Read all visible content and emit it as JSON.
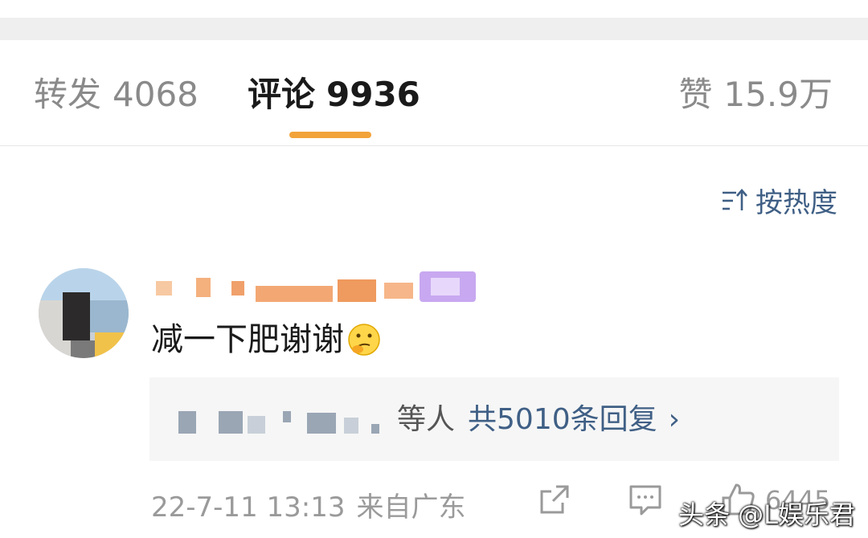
{
  "tabs": [
    {
      "label": "转发",
      "count": "4068"
    },
    {
      "label": "评论",
      "count": "9936"
    },
    {
      "label": "赞",
      "count": "15.9万"
    }
  ],
  "sort": {
    "label": "按热度",
    "icon": "sort-icon"
  },
  "colors": {
    "accent": "#f2a33a",
    "link": "#3f5f85",
    "muted": "#8a8a8a"
  },
  "comment": {
    "text": "减一下肥谢谢",
    "emoji": "thinking-face-emoji",
    "replies": {
      "others_label": "等人",
      "count_label": "共5010条回复",
      "chevron": "›"
    },
    "time": "22-7-11 13:13",
    "location": "来自广东",
    "like_count": "6445"
  },
  "watermark": "头条 @L娱乐君"
}
